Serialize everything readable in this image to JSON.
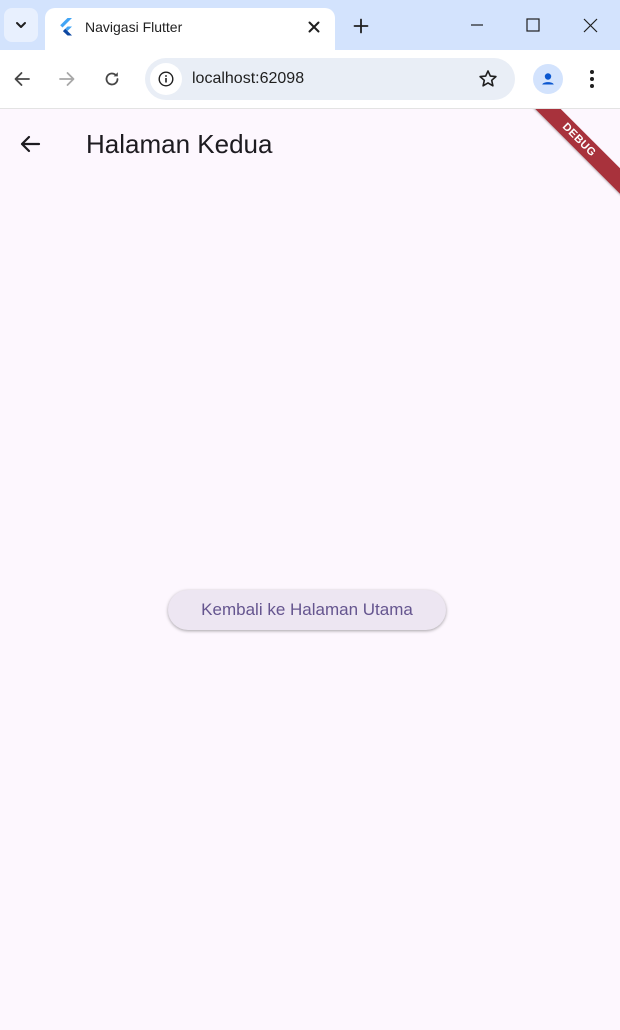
{
  "browser": {
    "tab_title": "Navigasi Flutter",
    "address": "localhost:62098",
    "icons": {
      "tab_search": "chevron-down-icon",
      "favicon": "flutter-logo",
      "tab_close": "close-icon",
      "new_tab": "plus-icon",
      "minimize": "minimize-icon",
      "maximize": "maximize-icon",
      "close_window": "close-icon",
      "back": "arrow-left-icon",
      "forward": "arrow-right-icon",
      "reload": "reload-icon",
      "site_info": "info-icon",
      "bookmark": "star-icon",
      "profile": "person-icon",
      "menu": "more-vert-icon"
    }
  },
  "app": {
    "title": "Halaman Kedua",
    "debug_banner": "DEBUG",
    "button_label": "Kembali ke Halaman Utama",
    "colors": {
      "background": "#fdf7fe",
      "button_bg": "#ede6f2",
      "button_text": "#65558f",
      "debug_banner": "#a8323c"
    }
  }
}
